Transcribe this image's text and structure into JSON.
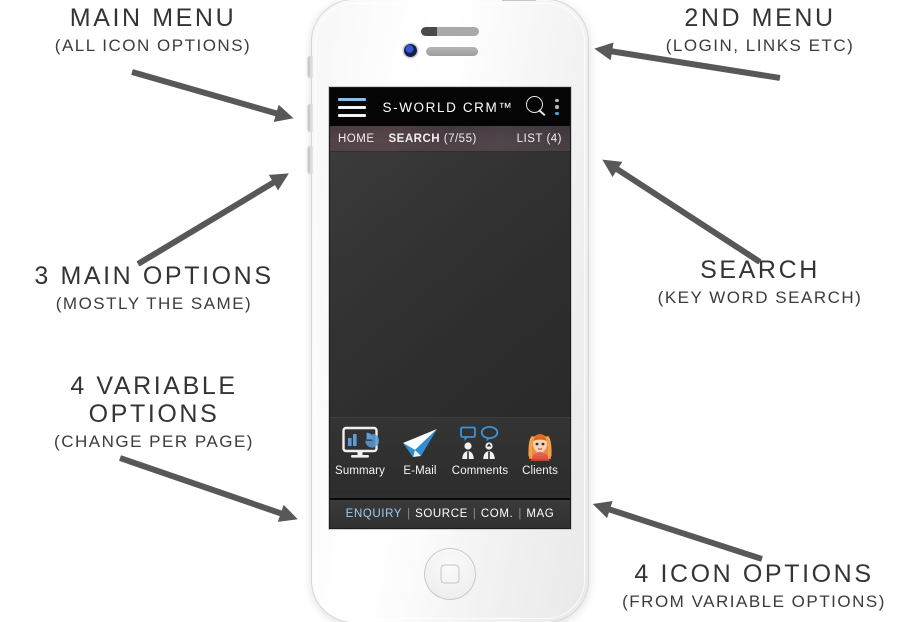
{
  "annotations": [
    {
      "id": "main-menu",
      "title": "MAIN MENU",
      "subtitle": "(ALL ICON OPTIONS)"
    },
    {
      "id": "2nd-menu",
      "title": "2ND MENU",
      "subtitle": "(LOGIN, LINKS ETC)"
    },
    {
      "id": "3-main",
      "title": "3 MAIN OPTIONS",
      "subtitle": "(MOSTLY THE SAME)"
    },
    {
      "id": "search",
      "title": "SEARCH",
      "subtitle": "(KEY WORD SEARCH)"
    },
    {
      "id": "4-variable",
      "title": "4 VARIABLE OPTIONS",
      "subtitle": "(CHANGE PER PAGE)"
    },
    {
      "id": "4-icon",
      "title": "4 ICON OPTIONS",
      "subtitle": "(FROM VARIABLE OPTIONS)"
    }
  ],
  "phone": {
    "hardware": {
      "earpiece": "earpiece-speaker",
      "front_camera": "front-camera",
      "home_button": "home-button",
      "side_buttons": [
        "mute-switch",
        "volume-up",
        "volume-down",
        "power-button"
      ]
    }
  },
  "app": {
    "title": "S-WORLD CRM™",
    "menu_icon": "hamburger-icon",
    "search_icon": "search-icon",
    "overflow_icon": "kebab-menu-icon",
    "tabs": [
      {
        "label": "HOME",
        "count": "",
        "active": false
      },
      {
        "label": "SEARCH",
        "count": "(7/55)",
        "active": true
      },
      {
        "label": "LIST",
        "count": "(4)",
        "active": false
      }
    ],
    "icons": [
      {
        "label": "Summary",
        "icon": "monitor-chart-icon"
      },
      {
        "label": "E-Mail",
        "icon": "paper-plane-icon"
      },
      {
        "label": "Comments",
        "icon": "two-people-speech-bubbles-icon"
      },
      {
        "label": "Clients",
        "icon": "woman-avatar-icon"
      }
    ],
    "links": [
      {
        "label": "ENQUIRY",
        "active": true
      },
      {
        "label": "SOURCE",
        "active": false
      },
      {
        "label": "COM.",
        "active": false
      },
      {
        "label": "MAG",
        "active": false
      }
    ],
    "link_separator": "|",
    "colors": {
      "app_bar_bg": "#050505",
      "accent_blue": "#8cbfe8",
      "active_link": "#9ecbf0",
      "kebab_blue": "#4aa3e0",
      "screen_bg": "#2f2f2f",
      "annotation_text": "#343434",
      "arrow": "#585858"
    }
  }
}
